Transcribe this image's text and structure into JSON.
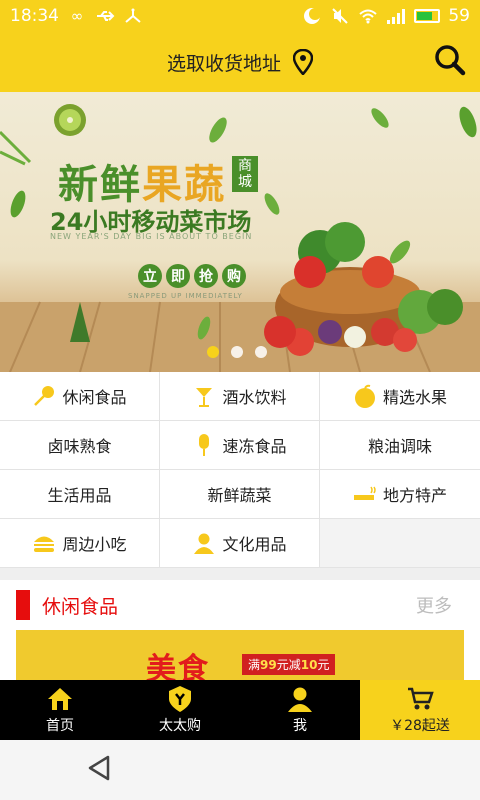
{
  "status_bar": {
    "time": "18:34",
    "battery_level": "59",
    "icons": [
      "infinity-icon",
      "usb-icon",
      "debug-icon",
      "moon-icon",
      "mute-icon",
      "wifi-icon",
      "signal-icon",
      "battery-icon"
    ]
  },
  "header": {
    "title": "选取收货地址",
    "location_icon": "location-pin-icon",
    "search_icon": "search-icon"
  },
  "banner": {
    "headline_green": "新鲜",
    "headline_orange": "果蔬",
    "badge": "商城",
    "subline": "24小时移动菜市场",
    "english_line": "NEW YEAR'S DAY BIG IS ABOUT TO BEGIN",
    "cta_chars": [
      "立",
      "即",
      "抢",
      "购"
    ],
    "english_cta": "SNAPPED UP IMMEDIATELY",
    "slides": 3,
    "active_slide": 1
  },
  "categories": [
    {
      "label": "休闲食品",
      "icon": "lollipop-icon"
    },
    {
      "label": "酒水饮料",
      "icon": "cocktail-icon"
    },
    {
      "label": "精选水果",
      "icon": "apple-icon"
    },
    {
      "label": "卤味熟食",
      "icon": ""
    },
    {
      "label": "速冻食品",
      "icon": "popsicle-icon"
    },
    {
      "label": "粮油调味",
      "icon": ""
    },
    {
      "label": "生活用品",
      "icon": ""
    },
    {
      "label": "新鲜蔬菜",
      "icon": ""
    },
    {
      "label": "地方特产",
      "icon": "cigarette-icon"
    },
    {
      "label": "周边小吃",
      "icon": "burger-icon"
    },
    {
      "label": "文化用品",
      "icon": "user-icon"
    }
  ],
  "section": {
    "title": "休闲食品",
    "more": "更多",
    "promo_big": "美食",
    "promo_tag_pre": "满",
    "promo_tag_num1": "99",
    "promo_tag_mid": "元减",
    "promo_tag_num2": "10",
    "promo_tag_post": "元"
  },
  "tabs": [
    {
      "label": "首页",
      "icon": "home-icon"
    },
    {
      "label": "太太购",
      "icon": "shield-icon"
    },
    {
      "label": "我",
      "icon": "person-icon"
    },
    {
      "label": "￥28起送",
      "icon": "cart-icon"
    }
  ],
  "colors": {
    "accent": "#f7d21c",
    "section_red": "#e60d0d",
    "banner_green": "#4a8f2a",
    "banner_orange": "#e9a623"
  }
}
